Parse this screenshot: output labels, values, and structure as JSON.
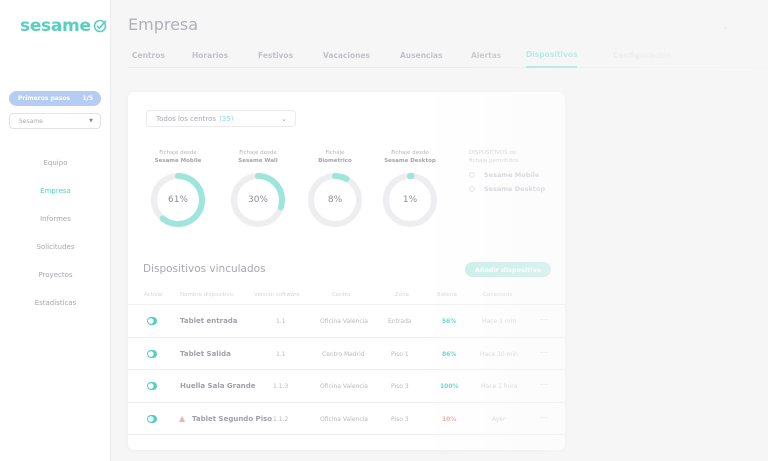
{
  "app": {
    "logo": "sesame"
  },
  "sidebar": {
    "first_steps_label": "Primeros pasos",
    "first_steps_progress": "1/5",
    "company_select_value": "Sesame",
    "items": [
      {
        "label": "Equipo"
      },
      {
        "label": "Empresa",
        "active": true
      },
      {
        "label": "Informes"
      },
      {
        "label": "Solicitudes"
      },
      {
        "label": "Proyectos"
      },
      {
        "label": "Estadísticas"
      }
    ]
  },
  "header": {
    "title": "Empresa",
    "tabs": [
      {
        "label": "Centros"
      },
      {
        "label": "Horarios"
      },
      {
        "label": "Festivos"
      },
      {
        "label": "Vacaciones"
      },
      {
        "label": "Ausencias"
      },
      {
        "label": "Alertas"
      },
      {
        "label": "Dispositivos",
        "active": true
      },
      {
        "label": "Configuración"
      }
    ]
  },
  "filters": {
    "centers_label": "Todos los centros",
    "centers_count": "(35)"
  },
  "stats": [
    {
      "line1": "Fichaje desde",
      "line2": "Sesame Mobile",
      "value": "61%",
      "fraction": 0.61
    },
    {
      "line1": "Fichaje desde",
      "line2": "Sesame Wall",
      "value": "30%",
      "fraction": 0.3
    },
    {
      "line1": "Fichaje",
      "line2": "Biométrico",
      "value": "8%",
      "fraction": 0.08
    },
    {
      "line1": "Fichaje desde",
      "line2": "Sesame Desktop",
      "value": "1%",
      "fraction": 0.01
    }
  ],
  "legend": {
    "title_line1": "DISPOSITIVOS de",
    "title_line2": "fichaje permitidos",
    "items": [
      "Sesame Mobile",
      "Sesame Desktop"
    ]
  },
  "devices": {
    "title": "Dispositivos vinculados",
    "add_button": "Añadir dispositivo",
    "columns": [
      "Activar",
      "Nombre dispositivo",
      "Versión software",
      "Centro",
      "Zona",
      "Batería",
      "Conectado"
    ],
    "rows": [
      {
        "name": "Tablet entrada",
        "version": "1.1",
        "center": "Oficina Valencia",
        "zone": "Entrada",
        "battery": "56%",
        "battery_status": "ok",
        "last_seen": "Hace 1 min"
      },
      {
        "name": "Tablet Salida",
        "version": "1.1",
        "center": "Centro Madrid",
        "zone": "Piso 1",
        "battery": "86%",
        "battery_status": "ok",
        "last_seen": "Hace 30 min"
      },
      {
        "name": "Huella Sala Grande",
        "version": "1.1.3",
        "center": "Oficina Valencia",
        "zone": "Piso 3",
        "battery": "100%",
        "battery_status": "ok",
        "last_seen": "Hace 1 hora"
      },
      {
        "name": "Tablet Segundo Piso",
        "version": "1.1.2",
        "center": "Oficina Valencia",
        "zone": "Piso 3",
        "battery": "10%",
        "battery_status": "low",
        "last_seen": "Ayer",
        "warning": true
      }
    ]
  },
  "colors": {
    "accent": "#4fd2c0",
    "ring": "#9ee6db",
    "track": "#eeeef1",
    "warning": "#f0a3a3",
    "progress_pill": "#b6ccf3"
  }
}
